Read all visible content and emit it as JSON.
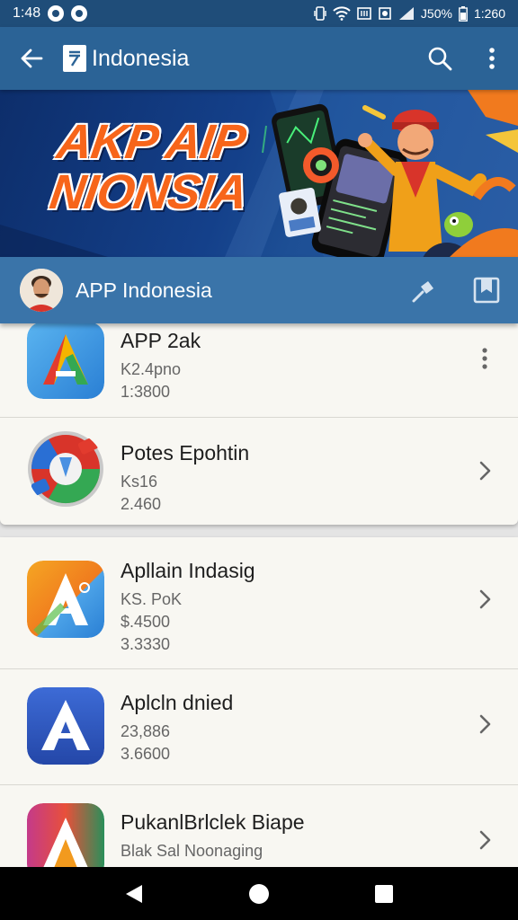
{
  "status_bar": {
    "time_left": "1:48",
    "battery": "J50%",
    "time_right": "1:260"
  },
  "app_bar": {
    "title": "Indonesia",
    "back_icon": "arrow-back-icon",
    "search_icon": "search-icon",
    "menu_icon": "more-vert-icon"
  },
  "banner": {
    "title_line1": "AKP AIP",
    "title_line2": "NIONSIA"
  },
  "channel": {
    "name": "APP Indonesia"
  },
  "apps_group1": [
    {
      "title": "APP 2ak",
      "line1": "K2.4pno",
      "line2": "1:3800",
      "action": "more-vert-icon"
    },
    {
      "title": "Potes Epohtin",
      "line1": "Ks16",
      "line2": "2.460",
      "action": "chevron-right-icon"
    }
  ],
  "apps_group2": [
    {
      "title": "Apllain Indasig",
      "line1": "KS. PoK",
      "line2": "$.4500",
      "line3": "3.3330",
      "action": "chevron-right-icon"
    },
    {
      "title": "Aplcln dnied",
      "line1": "23,886",
      "line2": "3.6600",
      "action": "chevron-right-icon"
    },
    {
      "title": "PukanlBrlclek Biape",
      "line1": "Blak Sal Noonaging",
      "action": "chevron-right-icon"
    }
  ],
  "colors": {
    "app_bar": "#2b6396",
    "status_bar": "#1f4d79",
    "channel_bar": "#3a74a9",
    "banner_text": "#f7651a"
  }
}
